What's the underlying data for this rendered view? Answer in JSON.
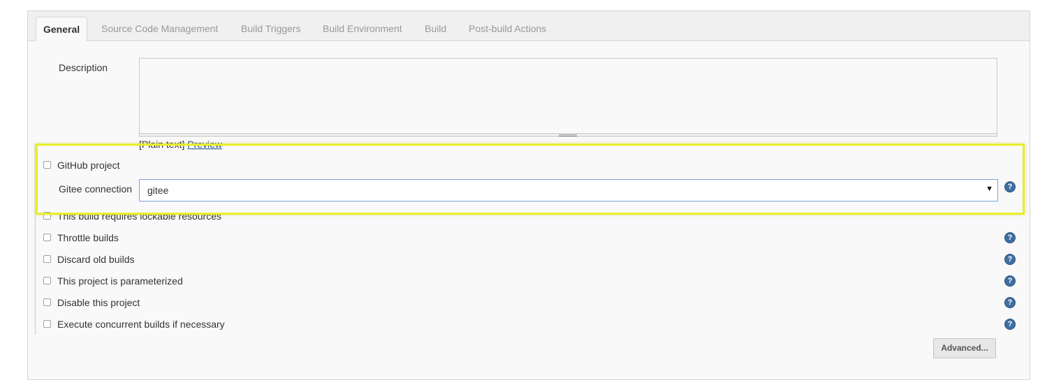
{
  "tabs": [
    {
      "label": "General",
      "active": true
    },
    {
      "label": "Source Code Management",
      "active": false
    },
    {
      "label": "Build Triggers",
      "active": false
    },
    {
      "label": "Build Environment",
      "active": false
    },
    {
      "label": "Build",
      "active": false
    },
    {
      "label": "Post-build Actions",
      "active": false
    }
  ],
  "description": {
    "label": "Description",
    "value": "",
    "plain_text": "[Plain text]",
    "preview_link": "Preview"
  },
  "github_project": {
    "label": "GitHub project",
    "checked": false
  },
  "gitee_connection": {
    "label": "Gitee connection",
    "selected": "gitee",
    "arrow": "▼"
  },
  "options": [
    {
      "label": "This build requires lockable resources",
      "checked": false
    },
    {
      "label": "Throttle builds",
      "checked": false
    },
    {
      "label": "Discard old builds",
      "checked": false
    },
    {
      "label": "This project is parameterized",
      "checked": false
    },
    {
      "label": "Disable this project",
      "checked": false
    },
    {
      "label": "Execute concurrent builds if necessary",
      "checked": false
    }
  ],
  "help_icon": "?",
  "advanced_button": "Advanced...",
  "colors": {
    "highlight": "#e8ee2a",
    "link": "#204a87",
    "help": "#3f6ea0"
  }
}
